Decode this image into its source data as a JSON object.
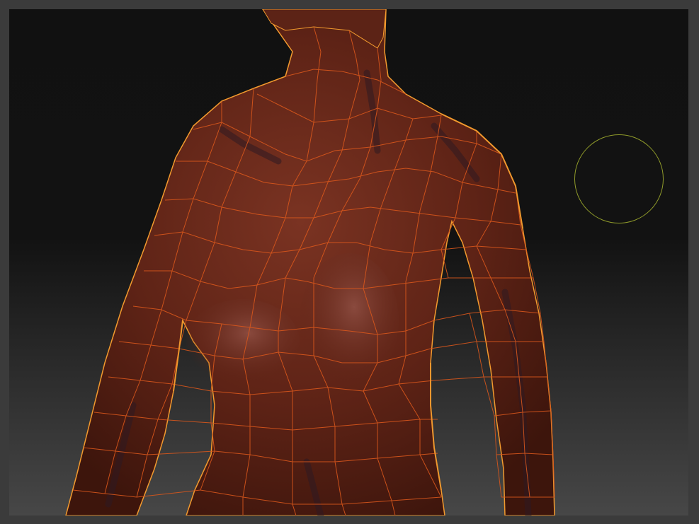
{
  "viewport": {
    "model": "female-torso-sculpt",
    "display": "polyframe-wireframe-overlay",
    "colors": {
      "background_top": "#111111",
      "background_bottom": "#474747",
      "frame": "#3b3b3b",
      "skin": "#6b2a1a",
      "wireframe": "#d9571c",
      "rim_light": "#f29a2e",
      "brush_cursor": "#8f9a2a"
    },
    "brush_cursor": {
      "icon": "brush-circle-icon"
    }
  }
}
